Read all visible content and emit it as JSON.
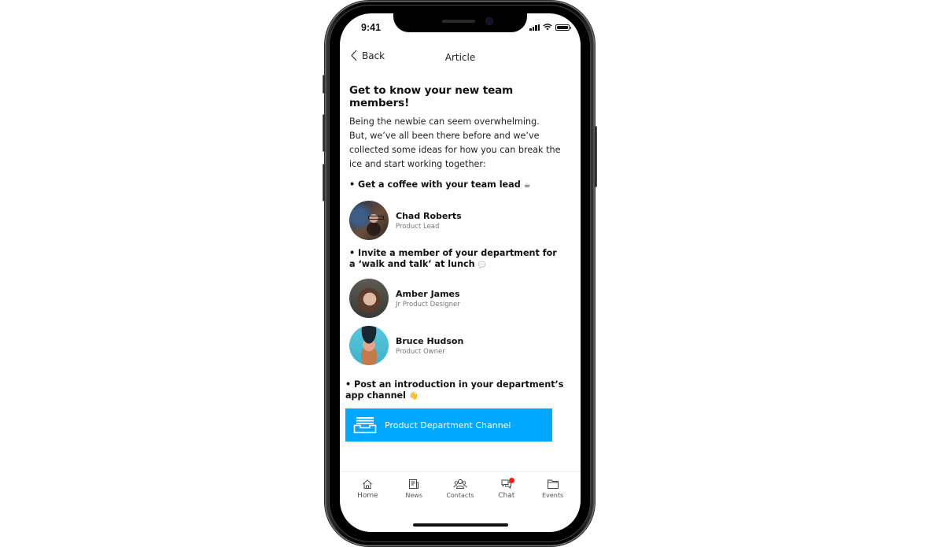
{
  "status_bar": {
    "time": "9:41"
  },
  "nav": {
    "back_label": "Back",
    "title": "Article"
  },
  "article": {
    "title": "Get to know your new team members!",
    "intro_line1": "Being the newbie can seem overwhelming.",
    "intro_line2": "But, we’ve all been there before and we’ve collected some ideas for how you can break the ice and start working together:",
    "bullets": [
      {
        "text": "• Get a coffee with your team lead",
        "emoji": "☕"
      },
      {
        "text": "• Invite a member of your department for a ‘walk and talk’ at lunch",
        "emoji": "💬"
      },
      {
        "text": "• Post an introduction in your department’s app channel",
        "emoji": "👋"
      }
    ],
    "people": [
      {
        "name": "Chad Roberts",
        "role": "Product Lead"
      },
      {
        "name": "Amber James",
        "role": "Jr Product Designer"
      },
      {
        "name": "Bruce Hudson",
        "role": "Product Owner"
      }
    ],
    "channel_button": {
      "label": "Product Department Channel",
      "icon": "inbox-tray-icon",
      "color": "#00a9ff"
    }
  },
  "tab_bar": {
    "items": [
      {
        "label": "Home",
        "icon": "home-icon"
      },
      {
        "label": "News",
        "icon": "newspaper-icon"
      },
      {
        "label": "Contacts",
        "icon": "contacts-icon"
      },
      {
        "label": "Chat",
        "icon": "chat-bubbles-icon",
        "has_badge": true,
        "badge_color": "#ff1a1a"
      },
      {
        "label": "Events",
        "icon": "folder-icon"
      }
    ]
  }
}
